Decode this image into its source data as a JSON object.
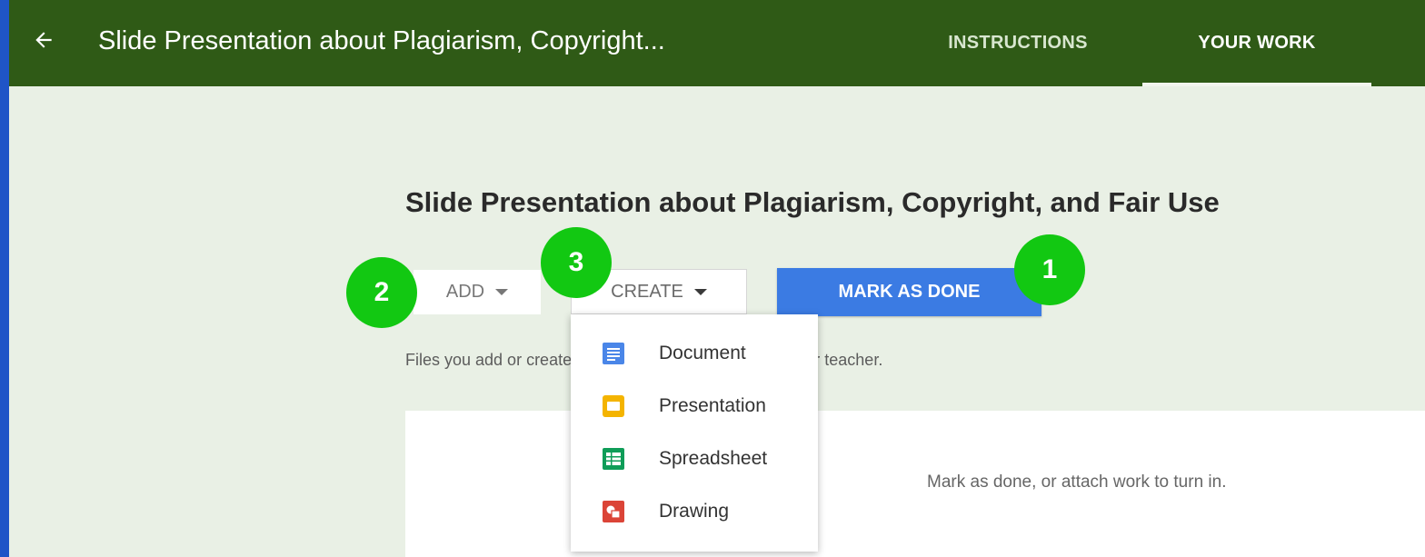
{
  "colors": {
    "outer_frame": "#1f55c7",
    "header_bg": "#2f5a16",
    "content_bg": "#e9f0e5",
    "primary_button": "#3b7be3",
    "badge": "#12c812",
    "doc_icon": "#4a86e8",
    "slides_icon": "#f4b400",
    "sheets_icon": "#0f9d58",
    "drawing_icon": "#db4437"
  },
  "header": {
    "back_icon": "arrow-left-icon",
    "title": "Slide Presentation about Plagiarism, Copyright...",
    "tabs": [
      {
        "label": "INSTRUCTIONS",
        "active": false
      },
      {
        "label": "YOUR WORK",
        "active": true
      }
    ]
  },
  "assignment": {
    "title": "Slide Presentation about Plagiarism, Copyright, and Fair Use",
    "helper_text": "Files you add or create can be viewed and edited by your teacher.",
    "empty_message": "Mark as done, or attach work to turn in."
  },
  "toolbar": {
    "add_label": "ADD",
    "create_label": "CREATE",
    "mark_done_label": "MARK AS DONE"
  },
  "create_menu": {
    "items": [
      {
        "label": "Document",
        "icon": "docs-icon"
      },
      {
        "label": "Presentation",
        "icon": "slides-icon"
      },
      {
        "label": "Spreadsheet",
        "icon": "sheets-icon"
      },
      {
        "label": "Drawing",
        "icon": "drawing-icon"
      }
    ]
  },
  "badges": [
    {
      "number": "1",
      "marks": "mark-as-done-button"
    },
    {
      "number": "2",
      "marks": "add-button"
    },
    {
      "number": "3",
      "marks": "create-button"
    }
  ]
}
